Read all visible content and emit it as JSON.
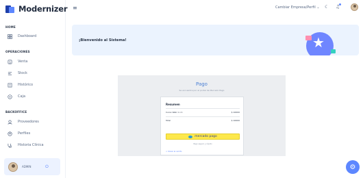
{
  "brand": {
    "name": "Modernizer"
  },
  "sidebar": {
    "sections": [
      {
        "label": "HOME"
      },
      {
        "label": "OPERACIONES"
      },
      {
        "label": "BACKOFFICE"
      }
    ],
    "items": [
      {
        "label": "Dashboard",
        "icon": "dashboard-icon"
      },
      {
        "label": "Venta",
        "icon": "cart-icon"
      },
      {
        "label": "Stock",
        "icon": "stock-icon"
      },
      {
        "label": "Histórico",
        "icon": "history-icon"
      },
      {
        "label": "Caja",
        "icon": "cash-icon"
      },
      {
        "label": "Proveedores",
        "icon": "truck-icon"
      },
      {
        "label": "Perfiles",
        "icon": "profile-icon"
      },
      {
        "label": "Historia Clínica",
        "icon": "clinical-icon"
      }
    ],
    "user": {
      "name": "ADMIN"
    }
  },
  "topbar": {
    "company_label": "Cambiar Empresa/Perfil ⌄"
  },
  "welcome": {
    "text": "¡Bienvenido al Sistema!"
  },
  "payment": {
    "title": "Pago",
    "subtitle": "Se encuentra por el portal de Mercado Pago",
    "summary_title": "Resumen",
    "line_item": {
      "label": "Curso Web 1 x 1",
      "amount": "$ 10000"
    },
    "total": {
      "label": "Total",
      "amount": "$ 10000"
    },
    "button_label": "mercado pago",
    "secure_text": "Pago seguro y rápido",
    "back_link": "< Volver al carrito"
  },
  "colors": {
    "accent": "#5d87ff",
    "banner_bg": "#ebf3fe",
    "mp_yellow": "#fde84c"
  }
}
